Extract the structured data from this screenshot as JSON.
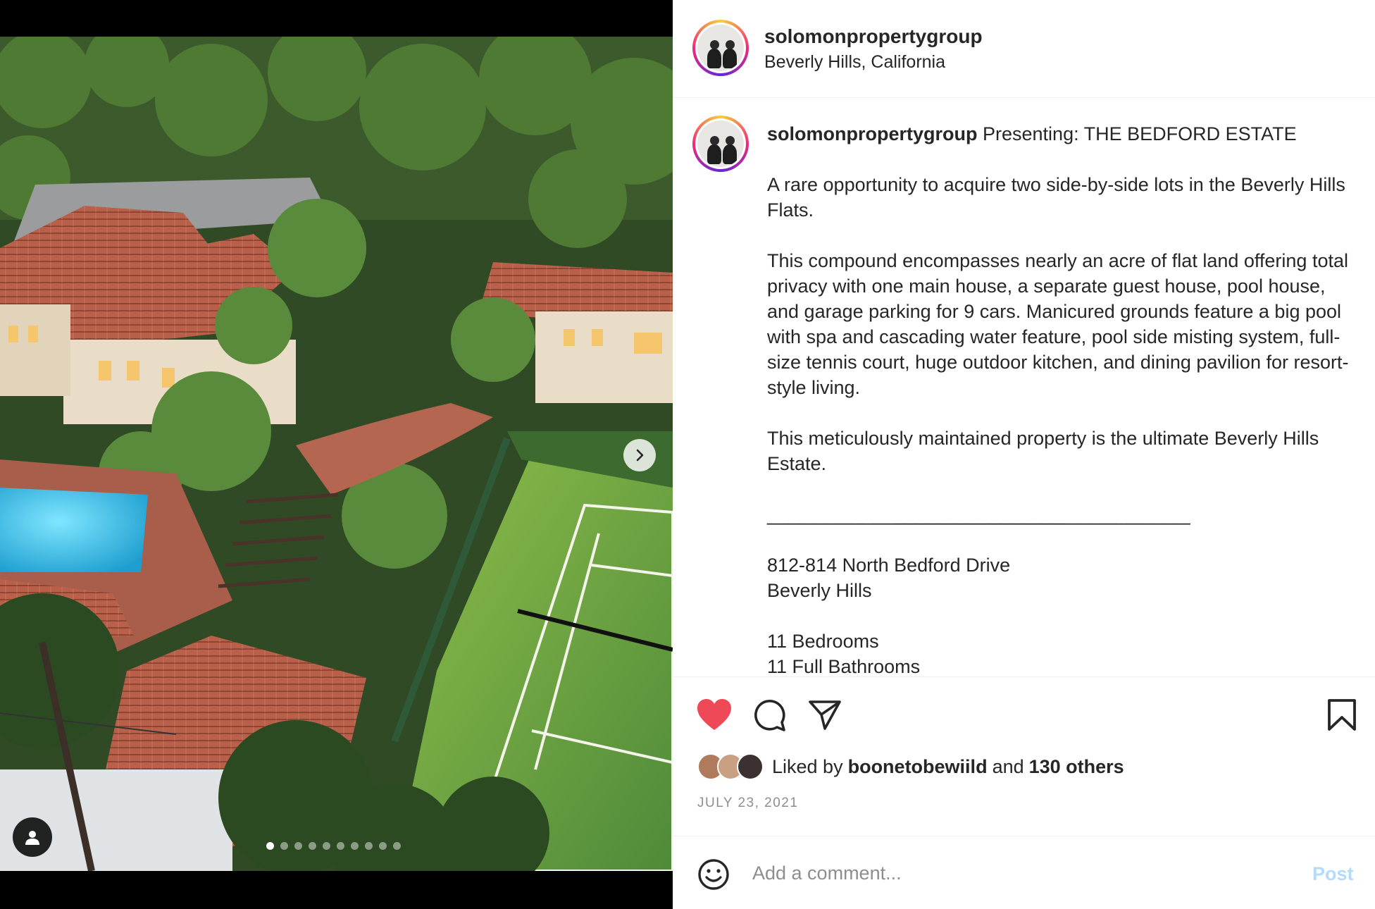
{
  "post": {
    "username": "solomonpropertygroup",
    "location": "Beverly Hills, California",
    "caption_title": " Presenting: THE BEDFORD ESTATE",
    "caption_body": "\n\nA rare opportunity to acquire two side-by-side lots in the Beverly Hills Flats.\n\nThis compound encompasses nearly an acre of flat land offering total privacy with one main house, a separate guest house, pool house, and garage parking for 9 cars. Manicured grounds feature a big pool with spa and cascading water feature, pool side misting system, full-size tennis court, huge outdoor kitchen, and dining pavilion for resort-style living.\n\nThis meticulously maintained property is the ultimate Beverly Hills Estate.\n\n________________________________________\n\n812-814 North Bedford Drive\nBeverly Hills\n\n11 Bedrooms\n11 Full Bathrooms",
    "liked_by_prefix": "Liked by",
    "liked_by_user": "boonetobewiild",
    "liked_by_and": "and",
    "liked_by_others": "130 others",
    "date": "JULY 23, 2021"
  },
  "carousel": {
    "total_slides": 10,
    "active_index": 0
  },
  "comment": {
    "placeholder": "Add a comment...",
    "post_label": "Post"
  },
  "icons": {
    "like": "heart-icon",
    "comment": "comment-icon",
    "share": "share-icon",
    "save": "bookmark-icon",
    "emoji": "emoji-icon",
    "more": "more-options-icon",
    "next": "chevron-right-icon",
    "tag": "user-tag-icon"
  },
  "colors": {
    "like": "#ed4956",
    "post_disabled": "#b3dbff",
    "muted": "#8e8e8e"
  }
}
